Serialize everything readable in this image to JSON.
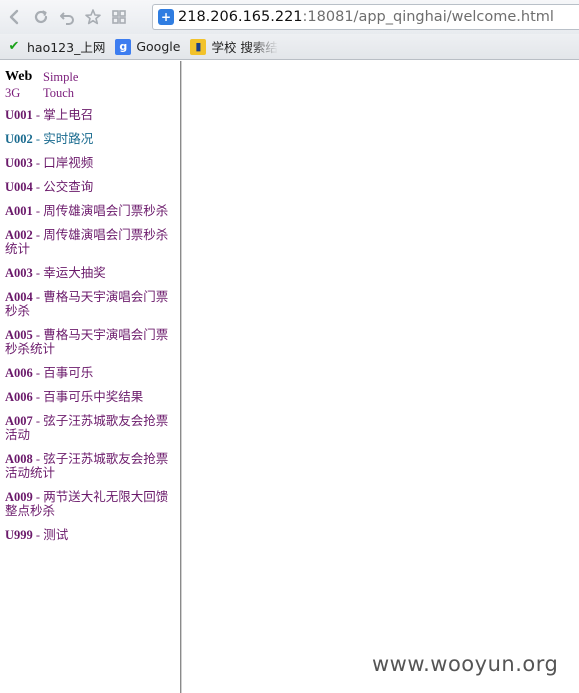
{
  "browser": {
    "url_host": "218.206.165.221",
    "url_rest": ":18081/app_qinghai/welcome.html",
    "bookmarks": [
      {
        "label": "hao123_上网",
        "icon": "hao123-icon"
      },
      {
        "label": "Google",
        "icon": "google-icon"
      },
      {
        "label": "学校 搜索结",
        "icon": "school-icon"
      }
    ]
  },
  "header": {
    "web": "Web",
    "simple": "Simple",
    "g3": "3G",
    "touch": "Touch"
  },
  "menu": {
    "items": [
      {
        "code": "U001",
        "text": " - 掌上电召"
      },
      {
        "code": "U002",
        "text": " - 实时路况"
      },
      {
        "code": "U003",
        "text": " - 口岸视频"
      },
      {
        "code": "U004",
        "text": " - 公交查询"
      },
      {
        "code": "A001",
        "text": " - 周传雄演唱会门票秒杀"
      },
      {
        "code": "A002",
        "text": " - 周传雄演唱会门票秒杀统计"
      },
      {
        "code": "A003",
        "text": " - 幸运大抽奖"
      },
      {
        "code": "A004",
        "text": " - 曹格马天宇演唱会门票秒杀"
      },
      {
        "code": "A005",
        "text": " - 曹格马天宇演唱会门票秒杀统计"
      },
      {
        "code": "A006",
        "text": " - 百事可乐"
      },
      {
        "code": "A006",
        "text": " - 百事可乐中奖结果"
      },
      {
        "code": "A007",
        "text": " - 弦子汪苏城歌友会抢票活动"
      },
      {
        "code": "A008",
        "text": " - 弦子汪苏城歌友会抢票活动统计"
      },
      {
        "code": "A009",
        "text": " - 两节送大礼无限大回馈整点秒杀"
      },
      {
        "code": "U999",
        "text": " - 测试"
      }
    ]
  },
  "watermark": "www.wooyun.org"
}
